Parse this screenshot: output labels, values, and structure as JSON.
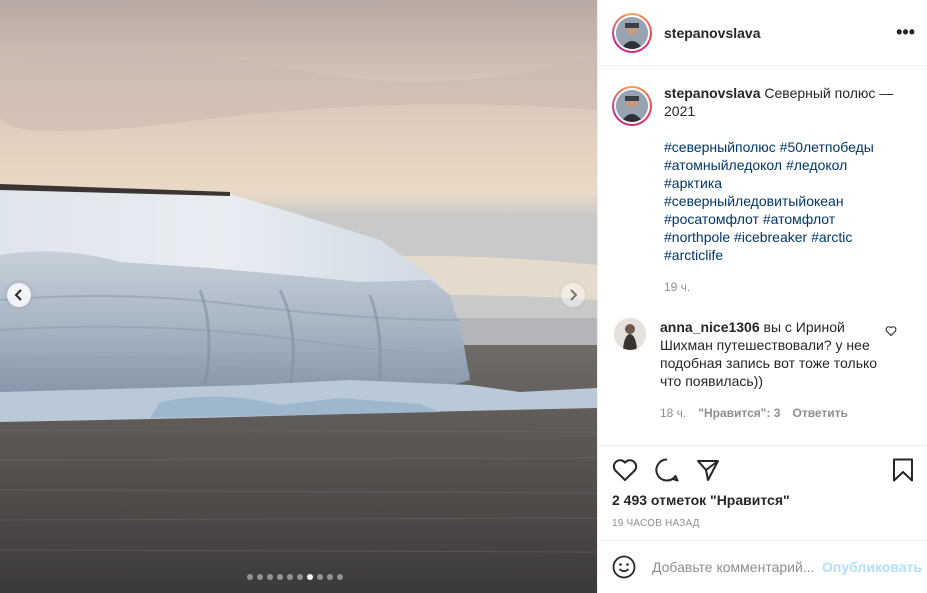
{
  "post": {
    "username": "stepanovslava",
    "more_label": "•••"
  },
  "caption": {
    "username": "stepanovslava",
    "text": "Северный полюс — 2021",
    "hashtags": [
      "#северныйполюс #50летпобеды",
      "#атомныйледокол #ледокол",
      "#арктика",
      "#северныйледовитыйокеан",
      "#росатомфлот #атомфлот",
      "#northpole #icebreaker #arctic",
      "#arcticlife"
    ],
    "time": "19 ч."
  },
  "comment": {
    "username": "anna_nice1306",
    "text": "вы с Ириной Шихман путешествовали? у нее подобная запись вот тоже только что появилась))",
    "time": "18 ч.",
    "likes": "\"Нравится\": 3",
    "reply": "Ответить"
  },
  "stats": {
    "likes": "2 493 отметок \"Нравится\"",
    "posted": "19 ЧАСОВ НАЗАД"
  },
  "add_comment": {
    "placeholder": "Добавьте комментарий...",
    "publish": "Опубликовать"
  },
  "carousel": {
    "slide_count": 10,
    "active_index": 6
  },
  "icons": {
    "prev": "chevron-left-icon",
    "next": "chevron-right-icon",
    "like": "heart-icon",
    "comment": "comment-icon",
    "share": "paper-plane-icon",
    "save": "bookmark-icon",
    "emoji": "smiley-icon"
  },
  "colors": {
    "link": "#00376b",
    "publish_disabled": "#b2dffc",
    "muted": "#8e8e8e"
  }
}
